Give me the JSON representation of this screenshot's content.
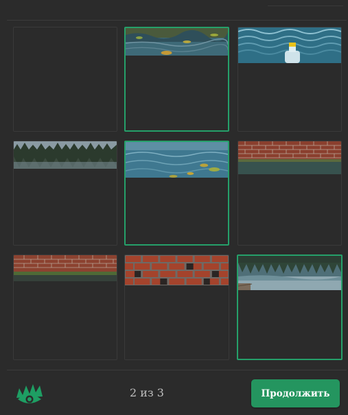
{
  "tiles": [
    {
      "image": "empty",
      "selected": false
    },
    {
      "image": "pond-water-lily-pads",
      "selected": true
    },
    {
      "image": "waves-with-bottle",
      "selected": false
    },
    {
      "image": "lake-tree-reflection",
      "selected": false
    },
    {
      "image": "pond-water-lily-pads",
      "selected": true
    },
    {
      "image": "brick-wall-by-water",
      "selected": false
    },
    {
      "image": "brick-wall-by-water",
      "selected": false
    },
    {
      "image": "red-brick-wall",
      "selected": false
    },
    {
      "image": "lake-tree-reflection-dock",
      "selected": true
    }
  ],
  "footer": {
    "logo_icon": "eye-logo-icon",
    "counter": "2 из 3",
    "continue_label": "Продолжить"
  },
  "colors": {
    "background": "#2b2b2b",
    "selected_border": "#25a06a",
    "button": "#24955f",
    "logo": "#1e9e63"
  }
}
